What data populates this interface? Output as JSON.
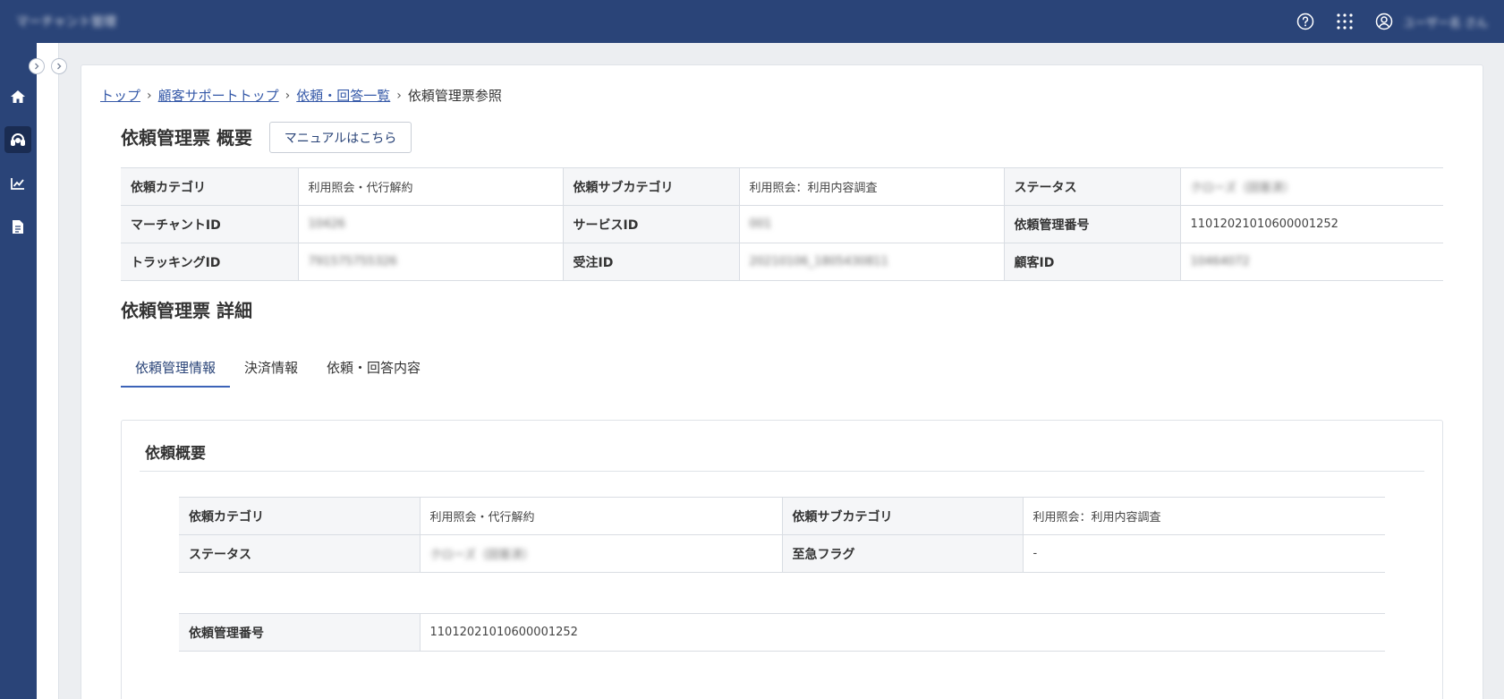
{
  "header": {
    "app_title": "マーチャント管理",
    "user_name": "ユーザー名 さん",
    "help_icon": "help-circle-icon",
    "apps_icon": "grid-dots-icon",
    "user_icon": "user-circle-icon"
  },
  "sidebar": {
    "items": [
      {
        "icon": "home-icon"
      },
      {
        "icon": "support-headset-icon"
      },
      {
        "icon": "chart-icon"
      },
      {
        "icon": "document-icon"
      }
    ]
  },
  "breadcrumb": {
    "items": [
      "トップ",
      "顧客サポートトップ",
      "依頼・回答一覧"
    ],
    "current": "依頼管理票参照"
  },
  "overview": {
    "title": "依頼管理票 概要",
    "manual_button": "マニュアルはこちら",
    "rows": [
      [
        {
          "label": "依頼カテゴリ",
          "value": "利用照会・代行解約"
        },
        {
          "label": "依頼サブカテゴリ",
          "value": "利用照会：利用内容調査"
        },
        {
          "label": "ステータス",
          "value": "クローズ（回答済）"
        }
      ],
      [
        {
          "label": "マーチャントID",
          "value": "10426"
        },
        {
          "label": "サービスID",
          "value": "001"
        },
        {
          "label": "依頼管理番号",
          "value": "11012021010600001252"
        }
      ],
      [
        {
          "label": "トラッキングID",
          "value": "791575755326"
        },
        {
          "label": "受注ID",
          "value": "20210106_1805430811"
        },
        {
          "label": "顧客ID",
          "value": "10464072"
        }
      ]
    ]
  },
  "detail": {
    "title": "依頼管理票 詳細",
    "tabs": [
      "依頼管理情報",
      "決済情報",
      "依頼・回答内容"
    ],
    "active_tab": 0,
    "panel_title": "依頼概要",
    "table1": [
      [
        {
          "label": "依頼カテゴリ",
          "value": "利用照会・代行解約"
        },
        {
          "label": "依頼サブカテゴリ",
          "value": "利用照会：利用内容調査"
        }
      ],
      [
        {
          "label": "ステータス",
          "value": "クローズ（回答済）"
        },
        {
          "label": "至急フラグ",
          "value": "-"
        }
      ]
    ],
    "table2": [
      {
        "label": "依頼管理番号",
        "value": "11012021010600001252"
      }
    ]
  },
  "colors": {
    "header_bg": "#2a4478",
    "sidebar_active": "#1a2c52",
    "link": "#3559a8",
    "tab_underline": "#3c63b8"
  }
}
